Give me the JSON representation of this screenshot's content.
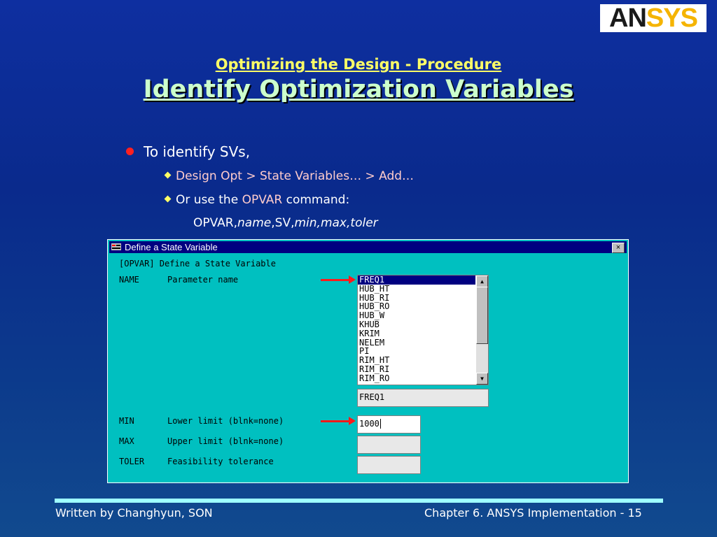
{
  "logo": {
    "part1": "AN",
    "part2": "SYS"
  },
  "slide": {
    "subtitle": "Optimizing the Design - Procedure",
    "title": "Identify Optimization Variables",
    "bullet": "To identify SVs,",
    "sub1": "Design Opt > State Variables… > Add…",
    "sub2_prefix": "Or use the ",
    "sub2_cmd": "OPVAR",
    "sub2_suffix": " command:",
    "syntax": {
      "cmd": "OPVAR,",
      "name": "name",
      "sv": ",SV,",
      "min": "min,",
      "max": "max,",
      "toler": "toler"
    }
  },
  "dialog": {
    "title": "Define a State Variable",
    "close": "×",
    "header": "[OPVAR] Define a State Variable",
    "rows": {
      "name": {
        "key": "NAME",
        "desc": "Parameter name"
      },
      "min": {
        "key": "MIN",
        "desc": "Lower limit (blnk=none)"
      },
      "max": {
        "key": "MAX",
        "desc": "Upper limit (blnk=none)"
      },
      "toler": {
        "key": "TOLER",
        "desc": "Feasibility tolerance"
      }
    },
    "list_items": [
      "FREQ1",
      "HUB_HT",
      "HUB_RI",
      "HUB_RO",
      "HUB_W",
      "KHUB",
      "KRIM",
      "NELEM",
      "PI",
      "RIM_HT",
      "RIM_RI",
      "RIM_RO"
    ],
    "selected_index": 0,
    "name_value": "FREQ1",
    "min_value": "1000",
    "max_value": "",
    "toler_value": "",
    "scroll_up": "▲",
    "scroll_down": "▼"
  },
  "footer": {
    "left": "Written by Changhyun, SON",
    "right": "Chapter 6. ANSYS Implementation - 15"
  },
  "colors": {
    "background": "#0a2a8c",
    "dialog": "#00c0c0",
    "titlebar": "#000080",
    "arrow": "#ff1a1a"
  }
}
